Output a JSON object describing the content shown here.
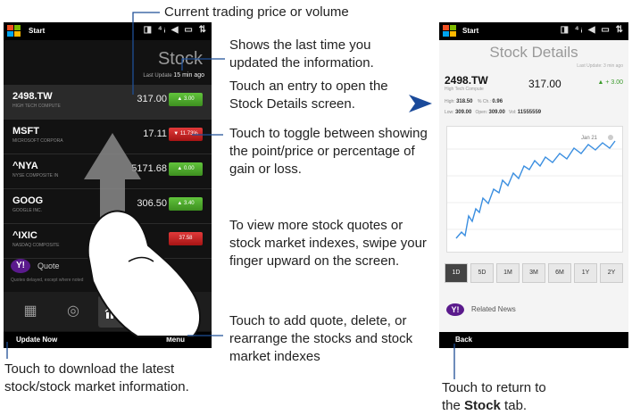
{
  "left_phone": {
    "status": {
      "start_label": "Start",
      "icons": "◨ ⁴ᵢ ◀ ▭ ⇅"
    },
    "title": "Stock",
    "last_update_label": "Last Update",
    "last_update_value": "15 min ago",
    "stocks": [
      {
        "symbol": "2498.TW",
        "name": "High Tech Compute",
        "price": "317.00",
        "change": "▲ 3.00",
        "direction": "up"
      },
      {
        "symbol": "MSFT",
        "name": "Microsoft Corpora",
        "price": "17.11",
        "change": "▼ 11.73%",
        "direction": "down"
      },
      {
        "symbol": "^NYA",
        "name": "NYSE Composite In",
        "price": "5171.68",
        "change": "▲ 0.00",
        "direction": "up"
      },
      {
        "symbol": "GOOG",
        "name": "Google Inc.",
        "price": "306.50",
        "change": "▲ 3.40",
        "direction": "up"
      },
      {
        "symbol": "^IXIC",
        "name": "Nasdaq Composite",
        "price": "",
        "change": "37.58",
        "direction": "down"
      }
    ],
    "yahoo_label": "Y!",
    "quote_label": "Quote",
    "disclaimer": "Quotes delayed, except where noted",
    "softkey_left": "Update Now",
    "softkey_right": "Menu"
  },
  "right_phone": {
    "status": {
      "start_label": "Start",
      "icons": "◨ ⁴ᵢ ◀ ▭ ⇅"
    },
    "title": "Stock Details",
    "last_update": "Last Update: 3 min ago",
    "symbol": "2498.TW",
    "name": "High Tech Compute",
    "price": "317.00",
    "change": "▲ + 3.00",
    "stats_row1": {
      "high_label": "High:",
      "high": "318.50",
      "pct_label": "% Ch.:",
      "pct": "0.96"
    },
    "stats_row2": {
      "low_label": "Low:",
      "low": "309.00",
      "open_label": "Open:",
      "open": "309.00",
      "vol_label": "Vol:",
      "vol": "11555559"
    },
    "chart_date": "Jan 21",
    "periods": [
      "1D",
      "5D",
      "1M",
      "3M",
      "6M",
      "1Y",
      "2Y"
    ],
    "selected_period": "1D",
    "yahoo_label": "Y!",
    "news_label": "Related News",
    "softkey_left": "Back"
  },
  "callouts": {
    "trading_price": "Current trading price or volume",
    "last_time": "Shows the last time you updated the information.",
    "open_details": "Touch an entry to open the Stock Details screen.",
    "toggle": "Touch to toggle between showing the point/price or percentage of gain or loss.",
    "swipe": "To view more stock quotes or stock market indexes, swipe your finger upward on the screen.",
    "menu": "Touch to add quote, delete, or rearrange the stocks and stock market indexes",
    "download": "Touch to download the latest stock/stock market information.",
    "return_prefix": "Touch to return to the ",
    "return_bold": "Stock",
    "return_suffix": " tab."
  }
}
